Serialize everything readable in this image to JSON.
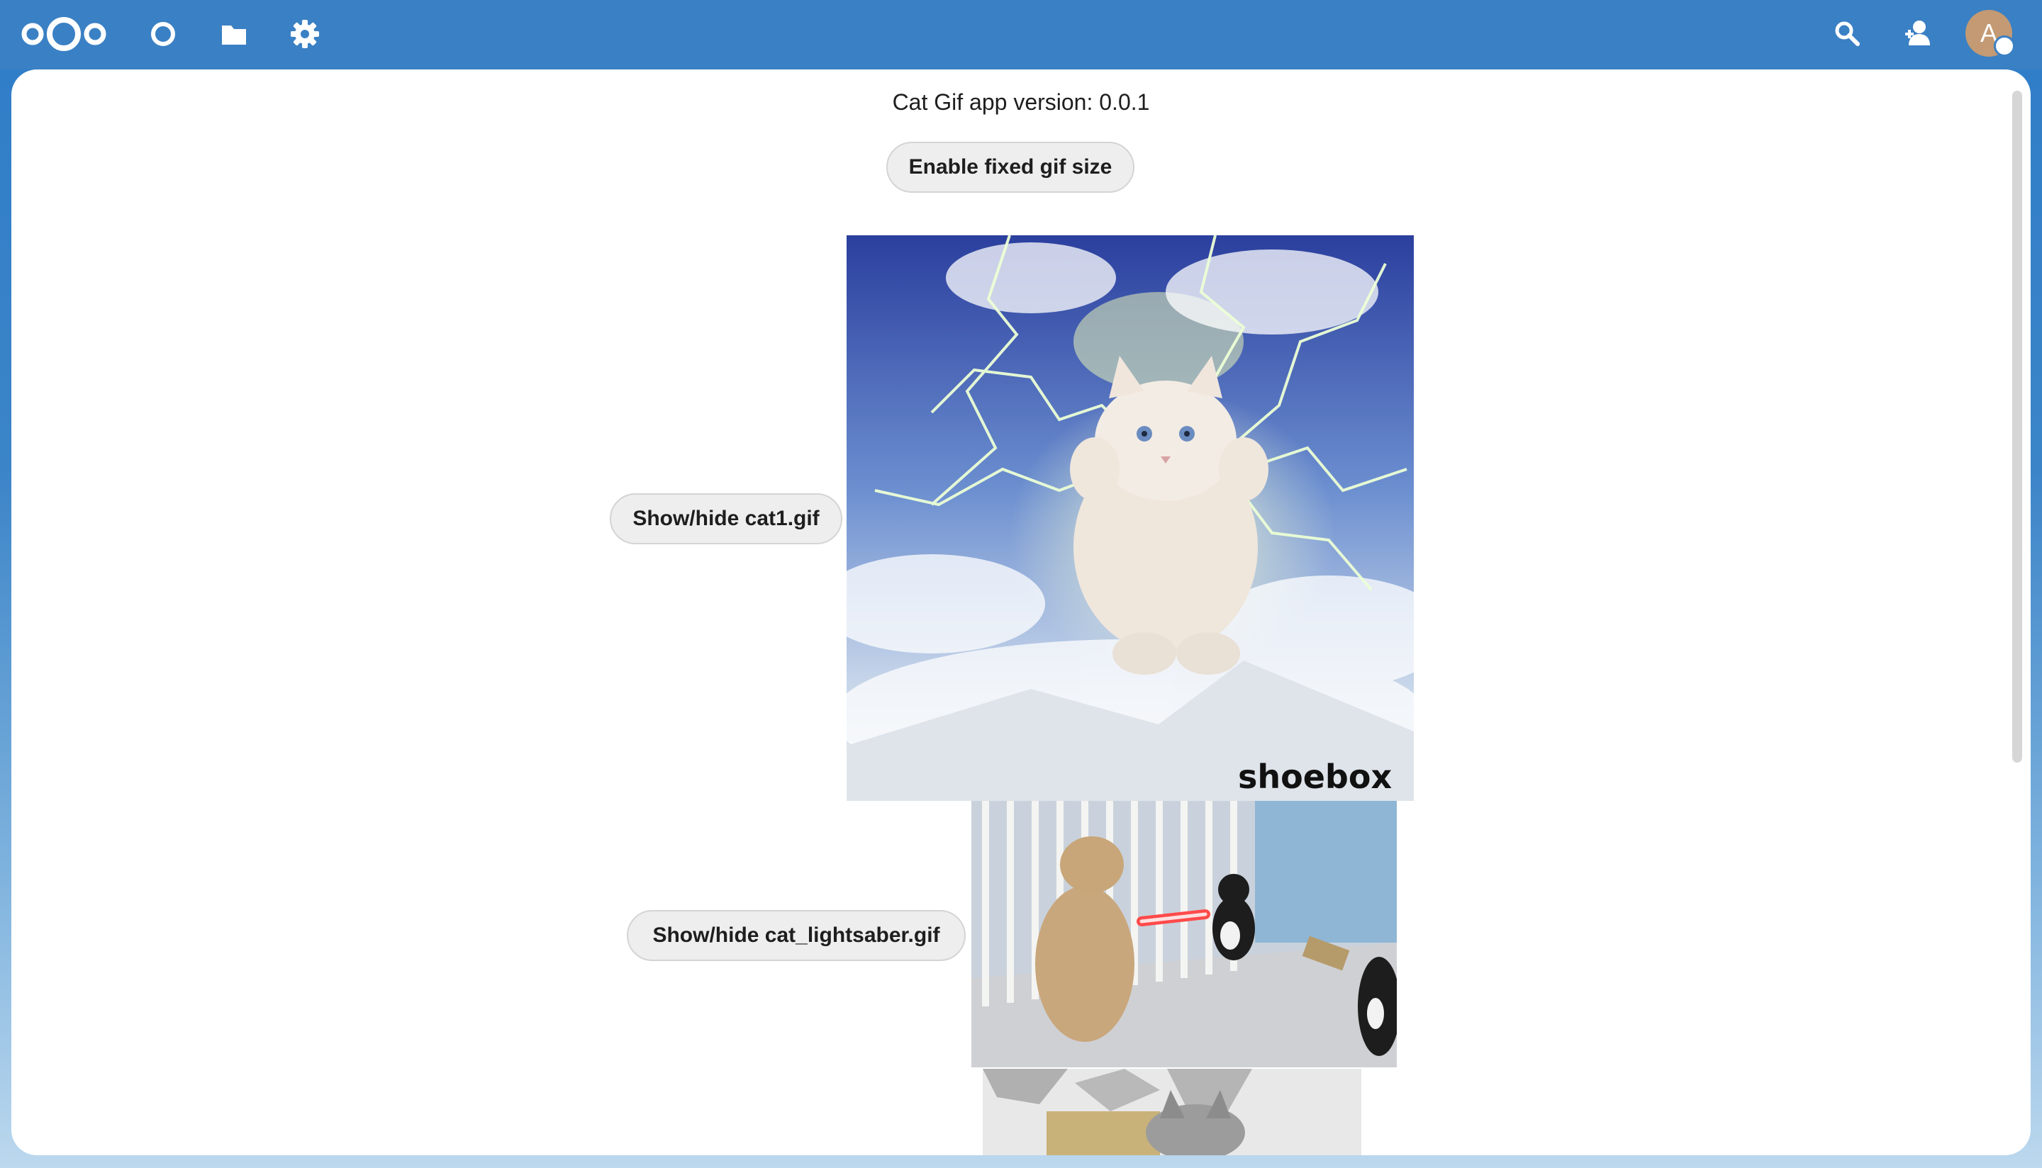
{
  "header": {
    "avatar_initial": "A",
    "nav_icons": [
      "nextcloud-logo",
      "dashboard-icon",
      "files-icon",
      "settings-icon"
    ],
    "right_icons": [
      "search-icon",
      "contacts-icon"
    ],
    "colors": {
      "header": "#3a80c4",
      "avatar": "#c39a73"
    }
  },
  "main": {
    "version_text": "Cat Gif app version: 0.0.1",
    "fixed_size_button": "Enable fixed gif size",
    "gifs": [
      {
        "button_label": "Show/hide cat1.gif",
        "watermark": "shoebox"
      },
      {
        "button_label": "Show/hide cat_lightsaber.gif"
      },
      {
        "button_label": ""
      }
    ]
  }
}
